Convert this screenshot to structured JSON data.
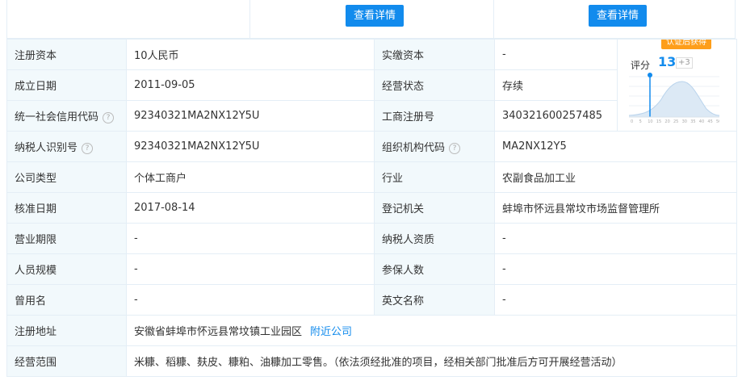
{
  "buttons": {
    "view_details_1": "查看详情",
    "view_details_2": "查看详情"
  },
  "rows": [
    {
      "l1": "注册资本",
      "v1": "10人民币",
      "l2": "实缴资本",
      "v2": "-"
    },
    {
      "l1": "成立日期",
      "v1": "2011-09-05",
      "l2": "经营状态",
      "v2": "存续"
    },
    {
      "l1": "统一社会信用代码",
      "v1": "92340321MA2NX12Y5U",
      "l2": "工商注册号",
      "v2": "340321600257485"
    },
    {
      "l1": "纳税人识别号",
      "v1": "92340321MA2NX12Y5U",
      "l2": "组织机构代码",
      "v2": "MA2NX12Y5"
    },
    {
      "l1": "公司类型",
      "v1": "个体工商户",
      "l2": "行业",
      "v2": "农副食品加工业"
    },
    {
      "l1": "核准日期",
      "v1": "2017-08-14",
      "l2": "登记机关",
      "v2": "蚌埠市怀远县常坟市场监督管理所"
    },
    {
      "l1": "营业期限",
      "v1": "-",
      "l2": "纳税人资质",
      "v2": "-"
    },
    {
      "l1": "人员规模",
      "v1": "-",
      "l2": "参保人数",
      "v2": "-"
    },
    {
      "l1": "曾用名",
      "v1": "-",
      "l2": "英文名称",
      "v2": "-"
    },
    {
      "l1": "注册地址",
      "v1": "安徽省蚌埠市怀远县常坟镇工业园区",
      "link": "附近公司"
    },
    {
      "l1": "经营范围",
      "v1": "米糠、稻糠、麸皮、糠粕、油糠加工零售。（依法须经批准的项目，经相关部门批准后方可开展经营活动）"
    }
  ],
  "score": {
    "badge": "认证后获得",
    "label": "评分",
    "value": "13",
    "plus": "+3",
    "axis_ticks": [
      "0",
      "5",
      "10",
      "15",
      "20",
      "25",
      "30",
      "35",
      "40",
      "45",
      "50"
    ]
  },
  "help_icon": "?",
  "colors": {
    "accent": "#128bed",
    "label_bg": "#f2f9fc",
    "border": "#e4eef6",
    "badge": "#fe9e1a"
  }
}
